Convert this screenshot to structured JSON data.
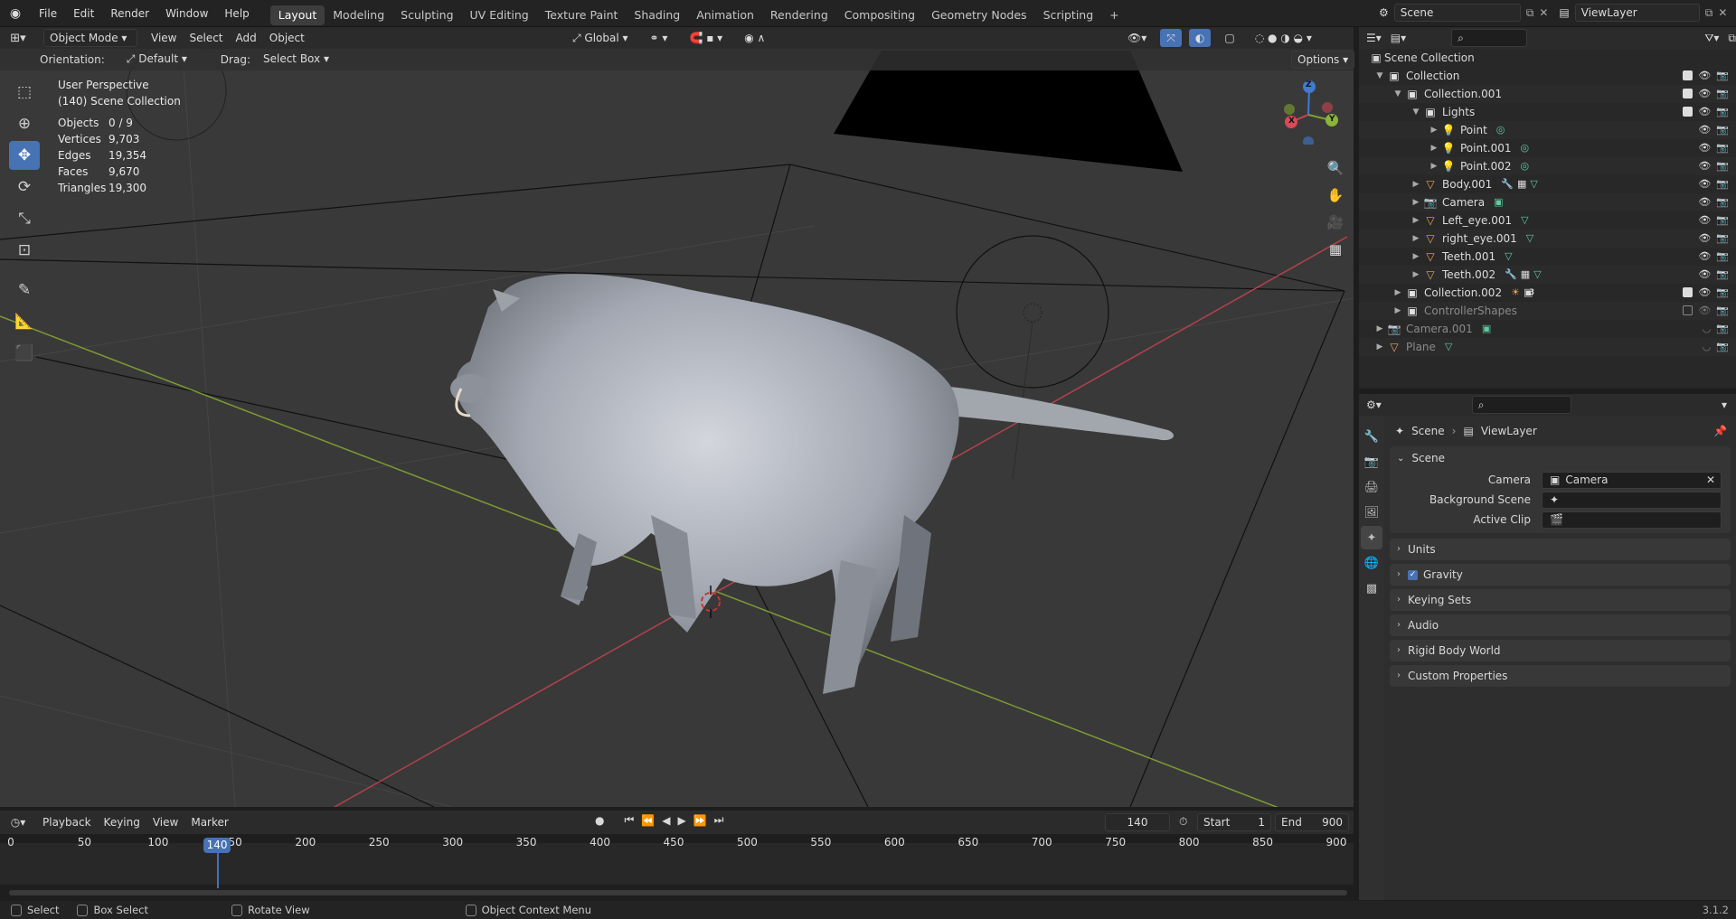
{
  "topbar": {
    "menus": [
      "File",
      "Edit",
      "Render",
      "Window",
      "Help"
    ],
    "workspaces": [
      "Layout",
      "Modeling",
      "Sculpting",
      "UV Editing",
      "Texture Paint",
      "Shading",
      "Animation",
      "Rendering",
      "Compositing",
      "Geometry Nodes",
      "Scripting"
    ],
    "active_workspace": "Layout",
    "add_tab": "+",
    "scene_name": "Scene",
    "view_layer": "ViewLayer"
  },
  "viewport": {
    "mode": "Object Mode",
    "menus": [
      "View",
      "Select",
      "Add",
      "Object"
    ],
    "transform_orientation": "Global",
    "orientation_label": "Orientation:",
    "orientation_value": "Default",
    "drag_label": "Drag:",
    "drag_value": "Select Box",
    "options_label": "Options",
    "view_name": "User Perspective",
    "view_collection": "(140) Scene Collection",
    "stats": [
      {
        "label": "Objects",
        "value": "0 / 9"
      },
      {
        "label": "Vertices",
        "value": "9,703"
      },
      {
        "label": "Edges",
        "value": "19,354"
      },
      {
        "label": "Faces",
        "value": "9,670"
      },
      {
        "label": "Triangles",
        "value": "19,300"
      }
    ],
    "gizmo_axes": {
      "x": "X",
      "y": "Y",
      "z": "Z"
    },
    "colors": {
      "x_axis": "#c94450",
      "y_axis": "#7fa32e",
      "accent": "#4772b3"
    }
  },
  "outliner": {
    "root": "Scene Collection",
    "rows": [
      {
        "label": "Collection",
        "type": "collection",
        "indent": 1,
        "expanded": true,
        "check": true
      },
      {
        "label": "Collection.001",
        "type": "collection",
        "indent": 2,
        "expanded": true,
        "check": true
      },
      {
        "label": "Lights",
        "type": "collection",
        "indent": 3,
        "expanded": true,
        "check": true
      },
      {
        "label": "Point",
        "type": "light",
        "indent": 4,
        "extras": [
          "light-data-icon"
        ]
      },
      {
        "label": "Point.001",
        "type": "light",
        "indent": 4,
        "extras": [
          "light-data-icon"
        ]
      },
      {
        "label": "Point.002",
        "type": "light",
        "indent": 4,
        "extras": [
          "light-data-icon"
        ]
      },
      {
        "label": "Body.001",
        "type": "mesh",
        "indent": 3,
        "extras": [
          "modifier-icon",
          "material-icon",
          "mesh-data-icon"
        ]
      },
      {
        "label": "Camera",
        "type": "camera",
        "indent": 3,
        "extras": [
          "camera-data-icon"
        ]
      },
      {
        "label": "Left_eye.001",
        "type": "mesh",
        "indent": 3,
        "extras": [
          "mesh-data-icon"
        ]
      },
      {
        "label": "right_eye.001",
        "type": "mesh",
        "indent": 3,
        "extras": [
          "mesh-data-icon"
        ]
      },
      {
        "label": "Teeth.001",
        "type": "mesh",
        "indent": 3,
        "extras": [
          "mesh-data-icon"
        ]
      },
      {
        "label": "Teeth.002",
        "type": "mesh",
        "indent": 3,
        "extras": [
          "modifier-icon",
          "material-icon",
          "mesh-data-icon"
        ]
      },
      {
        "label": "Collection.002",
        "type": "collection",
        "indent": 2,
        "expanded": false,
        "check": true,
        "extras": [
          "light-group-icon",
          "collection-icon"
        ],
        "badge": "3"
      },
      {
        "label": "ControllerShapes",
        "type": "collection",
        "indent": 2,
        "dim": true,
        "check": false
      },
      {
        "label": "Camera.001",
        "type": "camera",
        "indent": 1,
        "dim": true,
        "extras": [
          "camera-data-icon"
        ]
      },
      {
        "label": "Plane",
        "type": "mesh",
        "indent": 1,
        "dim": true,
        "extras": [
          "mesh-data-icon"
        ]
      }
    ]
  },
  "properties": {
    "breadcrumb": [
      "Scene",
      "ViewLayer"
    ],
    "scene_panel": "Scene",
    "fields": [
      {
        "label": "Camera",
        "value": "Camera"
      },
      {
        "label": "Background Scene",
        "value": ""
      },
      {
        "label": "Active Clip",
        "value": ""
      }
    ],
    "panels": [
      "Units",
      "Gravity",
      "Keying Sets",
      "Audio",
      "Rigid Body World",
      "Custom Properties"
    ]
  },
  "timeline": {
    "menus": [
      "Playback",
      "Keying",
      "View",
      "Marker"
    ],
    "current_frame": "140",
    "start_label": "Start",
    "start": "1",
    "end_label": "End",
    "end": "900",
    "ticks": [
      "0",
      "50",
      "100",
      "150",
      "200",
      "250",
      "300",
      "350",
      "400",
      "450",
      "500",
      "550",
      "600",
      "650",
      "700",
      "750",
      "800",
      "850",
      "900"
    ],
    "playhead": "140"
  },
  "statusbar": {
    "items": [
      "Select",
      "Box Select",
      "Rotate View",
      "Object Context Menu"
    ],
    "version": "3.1.2"
  }
}
